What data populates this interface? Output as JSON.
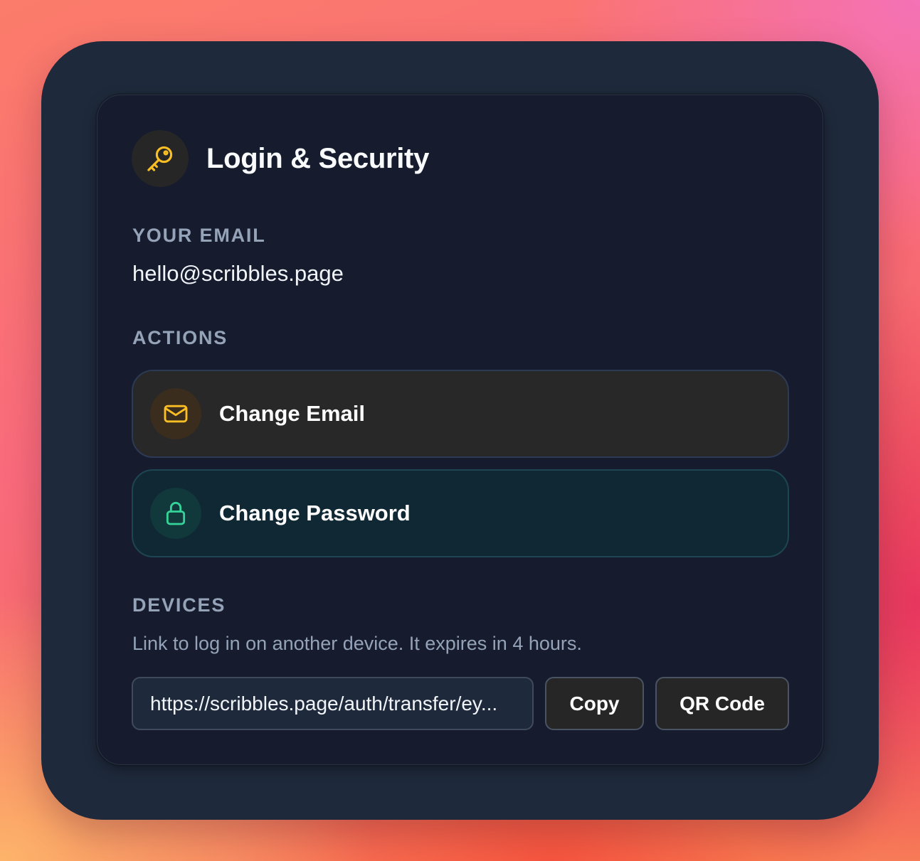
{
  "header": {
    "title": "Login & Security",
    "icon": "key-icon",
    "icon_color": "#fbbf24"
  },
  "email_section": {
    "label": "YOUR EMAIL",
    "value": "hello@scribbles.page"
  },
  "actions_section": {
    "label": "ACTIONS",
    "items": [
      {
        "label": "Change Email",
        "icon": "envelope-icon",
        "accent": "#fbbf24"
      },
      {
        "label": "Change Password",
        "icon": "lock-icon",
        "accent": "#34d399"
      }
    ]
  },
  "devices_section": {
    "label": "DEVICES",
    "description": "Link to log in on another device. It expires in 4 hours.",
    "link_value": "https://scribbles.page/auth/transfer/ey...",
    "copy_label": "Copy",
    "qr_label": "QR Code"
  },
  "colors": {
    "frame": "#1e293b",
    "card": "#161c2e",
    "muted_text": "#94a3b8"
  }
}
